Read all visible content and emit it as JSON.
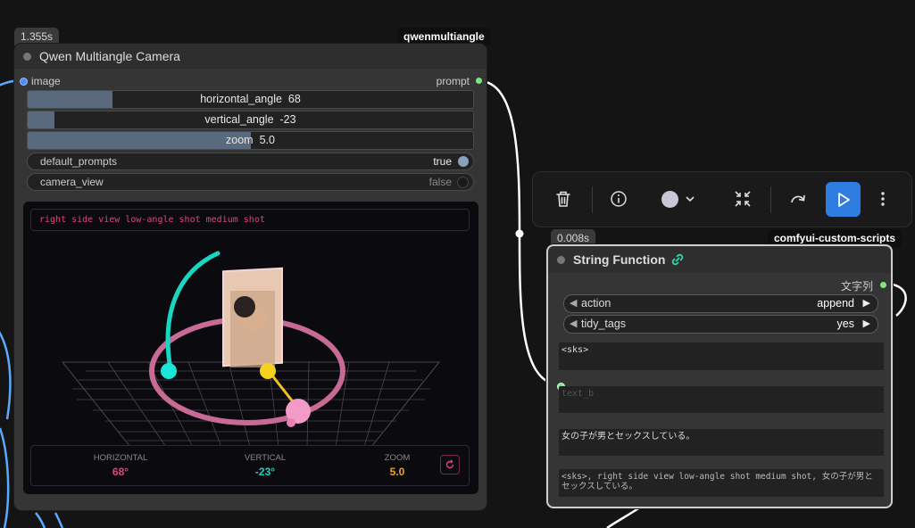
{
  "camera_node": {
    "time_badge": "1.355s",
    "pack_badge": "qwenmultiangle",
    "title": "Qwen Multiangle Camera",
    "input_label": "image",
    "output_label": "prompt",
    "widgets": {
      "horizontal_angle": {
        "label": "horizontal_angle",
        "value": "68",
        "fraction": 0.19
      },
      "vertical_angle": {
        "label": "vertical_angle",
        "value": "-23",
        "fraction": 0.06
      },
      "zoom": {
        "label": "zoom",
        "value": "5.0",
        "fraction": 0.5
      },
      "default_prompts": {
        "label": "default_prompts",
        "value": "true"
      },
      "camera_view": {
        "label": "camera_view",
        "value": "false"
      }
    },
    "viewer": {
      "prompt_text": "right side view low-angle shot medium shot",
      "stats": [
        {
          "label": "HORIZONTAL",
          "value": "68°",
          "color": "#e0457b"
        },
        {
          "label": "VERTICAL",
          "value": "-23°",
          "color": "#19d6c0"
        },
        {
          "label": "ZOOM",
          "value": "5.0",
          "color": "#f0a31e"
        }
      ]
    }
  },
  "toolbar": {
    "icons": [
      "trash-icon",
      "info-icon",
      "color-picker-icon",
      "collapse-icon",
      "redo-icon",
      "run-icon",
      "more-icon"
    ]
  },
  "string_node": {
    "time_badge": "0.008s",
    "pack_badge": "comfyui-custom-scripts",
    "title": "String Function",
    "output_label": "文字列",
    "action": {
      "label": "action",
      "value": "append"
    },
    "tidy_tags": {
      "label": "tidy_tags",
      "value": "yes"
    },
    "text_a": "<sks>",
    "text_b_placeholder": "text_b",
    "text_c": "女の子が男とセックスしている。",
    "result": "<sks>, right side view low-angle shot medium shot, 女の子が男とセックスしている。"
  },
  "colors": {
    "background": "#141414",
    "node": "#353535",
    "accent_blue": "#2f7de1",
    "link_green": "#7ee87e",
    "link_blue": "#5aa9ff"
  }
}
